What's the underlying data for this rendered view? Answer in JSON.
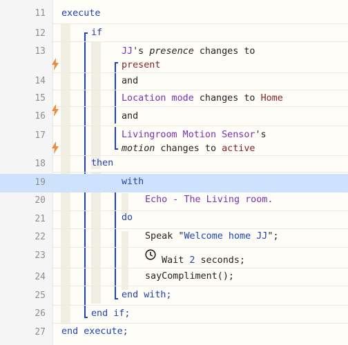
{
  "lines": [
    {
      "num": "11",
      "execute": "execute"
    },
    {
      "num": "12",
      "if": "if"
    },
    {
      "num": "13",
      "device": "JJ",
      "possessive": "'s ",
      "attr": "presence",
      "changes": " changes to",
      "value": "present"
    },
    {
      "num": "14",
      "and": "and"
    },
    {
      "num": "15",
      "device": "Location mode",
      "changes": " changes to ",
      "value": "Home"
    },
    {
      "num": "16",
      "and": "and"
    },
    {
      "num": "17",
      "device": "Livingroom Motion Sensor",
      "possessive": "'s",
      "attr": "motion",
      "changes": " changes to ",
      "value": "active"
    },
    {
      "num": "18",
      "then": "then"
    },
    {
      "num": "19",
      "with": "with"
    },
    {
      "num": "20",
      "device": "Echo - The Living room."
    },
    {
      "num": "21",
      "do": "do"
    },
    {
      "num": "22",
      "speak": "Speak ",
      "q1": "\"",
      "text": "Welcome home JJ",
      "q2": "\"",
      "semi": ";"
    },
    {
      "num": "23",
      "wait": " Wait ",
      "amount": "2",
      "unit": " seconds;"
    },
    {
      "num": "24",
      "call": "sayCompliment();"
    },
    {
      "num": "25",
      "end_with": "end with;"
    },
    {
      "num": "26",
      "end_if": "end if;"
    },
    {
      "num": "27",
      "end_execute": "end execute;"
    }
  ],
  "icons": {
    "trigger": "lightning-bolt-icon",
    "timer": "clock-icon"
  },
  "colors": {
    "keyword": "#1d3fc3",
    "device": "#7b2fc2",
    "value": "#8d1d1d",
    "selection": "#cfe2fb",
    "trigger_bolt": "#f08a3c"
  }
}
